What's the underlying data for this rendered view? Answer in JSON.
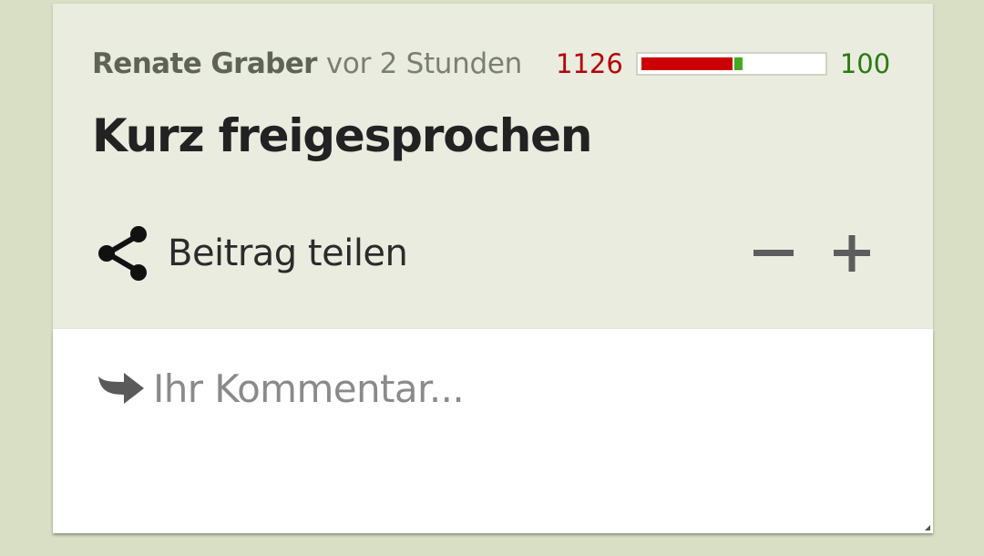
{
  "post": {
    "author": "Renate Graber",
    "time": "vor 2 Stunden",
    "title": "Kurz freigesprochen"
  },
  "rating": {
    "negative_count": "1126",
    "positive_count": "100",
    "negative_fraction": 0.918,
    "positive_fraction": 0.082,
    "negative_color": "#cc0000",
    "positive_color": "#44aa22"
  },
  "actions": {
    "share_label": "Beitrag teilen",
    "share_icon": "share-icon",
    "minus_icon": "minus-icon",
    "plus_icon": "plus-icon"
  },
  "comment": {
    "placeholder": "Ihr Kommentar...",
    "reply_icon": "reply-arrow-icon"
  }
}
